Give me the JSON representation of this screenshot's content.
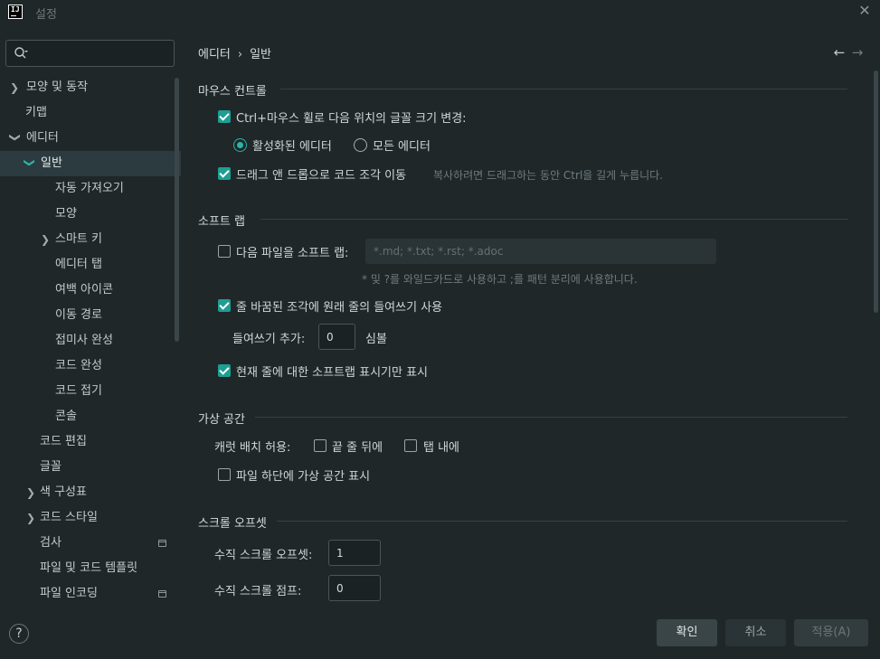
{
  "window": {
    "title": "설정"
  },
  "search": {
    "placeholder": ""
  },
  "tree": [
    {
      "label": "모양 및 동작"
    },
    {
      "label": "키맵"
    },
    {
      "label": "에디터"
    },
    {
      "label": "일반"
    },
    {
      "label": "자동 가져오기"
    },
    {
      "label": "모양"
    },
    {
      "label": "스마트 키"
    },
    {
      "label": "에디터 탭"
    },
    {
      "label": "여백 아이콘"
    },
    {
      "label": "이동 경로"
    },
    {
      "label": "접미사 완성"
    },
    {
      "label": "코드 완성"
    },
    {
      "label": "코드 접기"
    },
    {
      "label": "콘솔"
    },
    {
      "label": "코드 편집"
    },
    {
      "label": "글꼴"
    },
    {
      "label": "색 구성표"
    },
    {
      "label": "코드 스타일"
    },
    {
      "label": "검사"
    },
    {
      "label": "파일 및 코드 템플릿"
    },
    {
      "label": "파일 인코딩"
    }
  ],
  "breadcrumb": {
    "parent": "에디터",
    "separator": "›",
    "current": "일반"
  },
  "nav": {
    "back": "←",
    "forward": "→"
  },
  "mouse": {
    "title": "마우스 컨트롤",
    "wheel_zoom": "Ctrl+마우스 휠로 다음 위치의 글꼴 크기 변경:",
    "active_editor": "활성화된 에디터",
    "all_editors": "모든 에디터",
    "drag_drop": "드래그 앤 드롭으로 코드 조각 이동",
    "drag_hint": "복사하려면 드래그하는 동안 Ctrl을 길게 누릅니다."
  },
  "soft_wrap": {
    "title": "소프트 랩",
    "files_label": "다음 파일을 소프트 랩:",
    "files_placeholder": "*.md; *.txt; *.rst; *.adoc",
    "files_hint": "* 및 ?를 와일드카드로 사용하고 ;를 패턴 분리에 사용합니다.",
    "indent_wrapped": "줄 바꿈된 조각에 원래 줄의 들여쓰기 사용",
    "indent_add_label": "들여쓰기 추가:",
    "indent_add_value": "0",
    "indent_unit": "심볼",
    "current_line_only": "현재 줄에 대한 소프트랩 표시기만 표시"
  },
  "virtual_space": {
    "title": "가상 공간",
    "caret_label": "캐럿 배치 허용:",
    "after_eol": "끝 줄 뒤에",
    "inside_tabs": "탭 내에",
    "end_of_file": "파일 하단에 가상 공간 표시"
  },
  "scroll_offset": {
    "title": "스크롤 오프셋",
    "vertical_label": "수직 스크롤 오프셋:",
    "vertical_value": "1",
    "jump_label": "수직 스크롤 점프:",
    "jump_value": "0"
  },
  "buttons": {
    "ok": "확인",
    "cancel": "취소",
    "apply": "적용(A)",
    "help": "?"
  },
  "colors": {
    "accent": "#1f9e92",
    "background": "#1f2729",
    "selection": "#2c3b3f"
  }
}
